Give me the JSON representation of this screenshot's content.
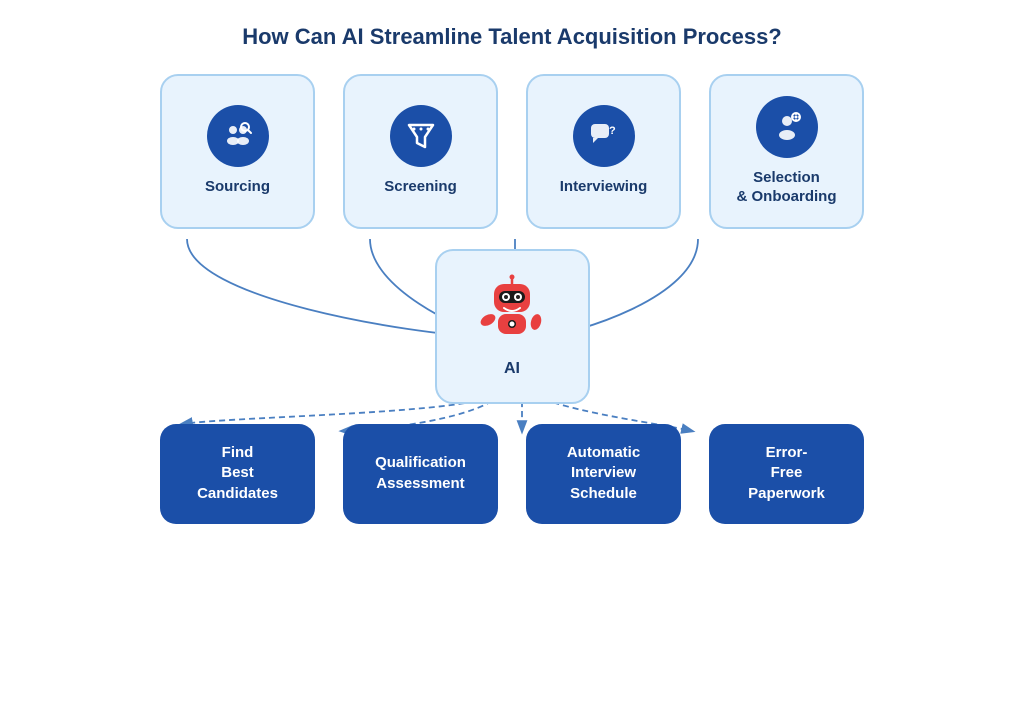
{
  "title": "How Can AI Streamline Talent Acquisition Process?",
  "top_cards": [
    {
      "id": "sourcing",
      "label": "Sourcing",
      "icon": "👥"
    },
    {
      "id": "screening",
      "label": "Screening",
      "icon": "🔽"
    },
    {
      "id": "interviewing",
      "label": "Interviewing",
      "icon": "💬"
    },
    {
      "id": "selection-onboarding",
      "label": "Selection\n& Onboarding",
      "icon": "⚙️"
    }
  ],
  "ai_card": {
    "label": "AI"
  },
  "bottom_cards": [
    {
      "id": "find-candidates",
      "label": "Find\nBest\nCandidates"
    },
    {
      "id": "qualification",
      "label": "Qualification\nAssessment"
    },
    {
      "id": "interview-schedule",
      "label": "Automatic\nInterview\nSchedule"
    },
    {
      "id": "paperwork",
      "label": "Error-\nFree\nPaperwork"
    }
  ]
}
